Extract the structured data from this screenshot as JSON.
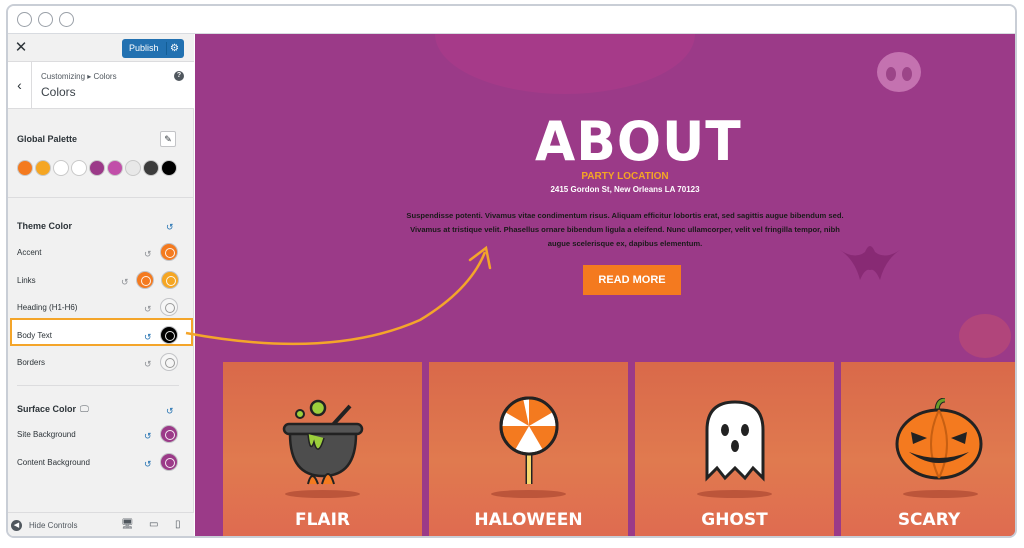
{
  "window": {
    "dots": [
      "",
      "",
      ""
    ]
  },
  "sidebar": {
    "close_label": "✕",
    "publish_label": "Publish",
    "gear_icon": "⚙",
    "back_icon": "‹",
    "breadcrumb": "Customizing ▸ Colors",
    "section_title": "Colors",
    "help_icon": "?",
    "global_palette_label": "Global Palette",
    "pencil_icon": "✎",
    "palette": [
      "#f47a1f",
      "#f5a623",
      "#ffffff",
      "#ffffff",
      "#9b3a88",
      "#c14fa9",
      "#e8e8e8",
      "#3c3c3c",
      "#000000"
    ],
    "theme_color_label": "Theme Color",
    "reset_icon": "↺",
    "theme_colors": [
      {
        "label": "Accent",
        "colors": [
          "#f47a1f"
        ]
      },
      {
        "label": "Links",
        "colors": [
          "#f47a1f",
          "#f5a623"
        ]
      },
      {
        "label": "Heading (H1-H6)",
        "colors": [
          "#ffffff"
        ]
      },
      {
        "label": "Body Text",
        "colors": [
          "#000000"
        ]
      },
      {
        "label": "Borders",
        "colors": [
          "#ffffff"
        ]
      }
    ],
    "surface_color_label": "Surface Color",
    "monitor_icon": "🖵",
    "surface_colors": [
      {
        "label": "Site Background",
        "colors": [
          "#9b3a88"
        ]
      },
      {
        "label": "Content Background",
        "colors": [
          "#9b3a88"
        ]
      }
    ],
    "hide_controls_icon": "◀",
    "hide_controls_label": "Hide Controls",
    "device_icons": [
      "🖥",
      "▭",
      "▯"
    ]
  },
  "preview": {
    "heading": "ABOUT",
    "subheading": "PARTY LOCATION",
    "address": "2415 Gordon St, New Orleans LA 70123",
    "paragraph": "Suspendisse potenti. Vivamus vitae condimentum risus. Aliquam efficitur lobortis erat, sed sagittis augue bibendum sed. Vivamus at tristique velit. Phasellus ornare bibendum ligula a eleifend. Nunc ullamcorper, velit vel fringilla tempor, nibh augue scelerisque ex, dapibus elementum.",
    "button_label": "READ MORE",
    "cards": [
      {
        "title": "FLAIR",
        "icon": "cauldron-icon"
      },
      {
        "title": "HALOWEEN",
        "icon": "lollipop-icon"
      },
      {
        "title": "GHOST",
        "icon": "ghost-icon"
      },
      {
        "title": "SCARY",
        "icon": "pumpkin-icon"
      }
    ],
    "accent_color": "#f47a1f",
    "background_color": "#9b3a88"
  }
}
